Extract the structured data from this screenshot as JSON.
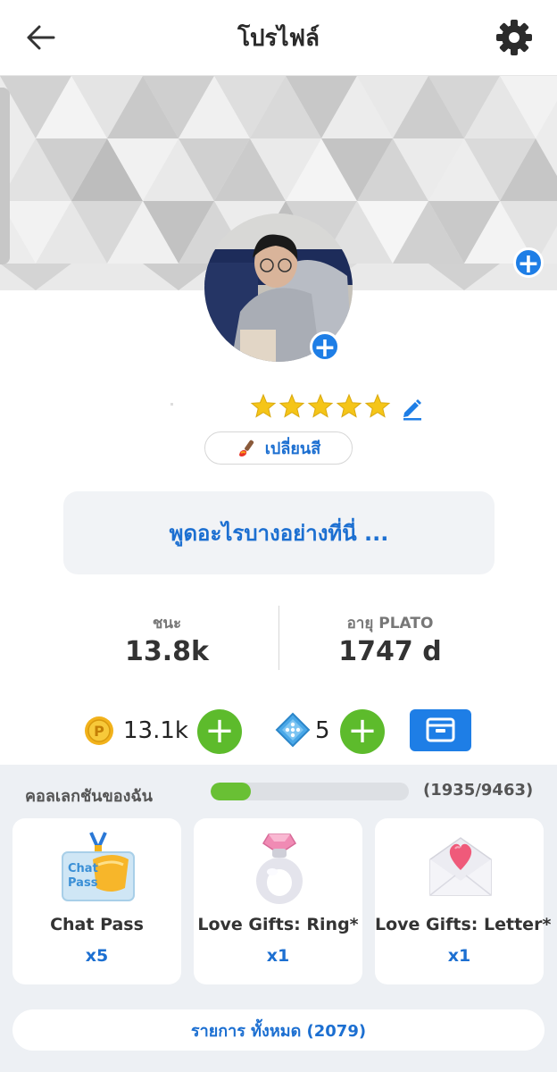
{
  "header": {
    "title": "โปรไฟล์",
    "back_icon": "arrow-left-icon",
    "settings_icon": "gear-icon"
  },
  "profile": {
    "stars": 5,
    "change_color_label": "เปลี่ยนสี",
    "status_placeholder": "พูดอะไรบางอย่างที่นี่ ..."
  },
  "stats": {
    "wins_label": "ชนะ",
    "wins_value": "13.8k",
    "age_label": "อายุ PLATO",
    "age_value": "1747 d"
  },
  "currency": {
    "coins": "13.1k",
    "dice": "5"
  },
  "collection": {
    "label": "คอลเลกชันของฉัน",
    "progress_text": "(1935/9463)",
    "progress_fraction": 0.2045,
    "items": [
      {
        "name": "Chat Pass",
        "qty": "x5"
      },
      {
        "name": "Love Gifts: Ring*",
        "qty": "x1"
      },
      {
        "name": "Love Gifts: Letter*",
        "qty": "x1"
      }
    ],
    "all_label": "รายการ ทั้งหมด (2079)"
  },
  "colors": {
    "accent": "#1e7ee6",
    "green": "#5dbb2c",
    "star": "#f5c518"
  }
}
